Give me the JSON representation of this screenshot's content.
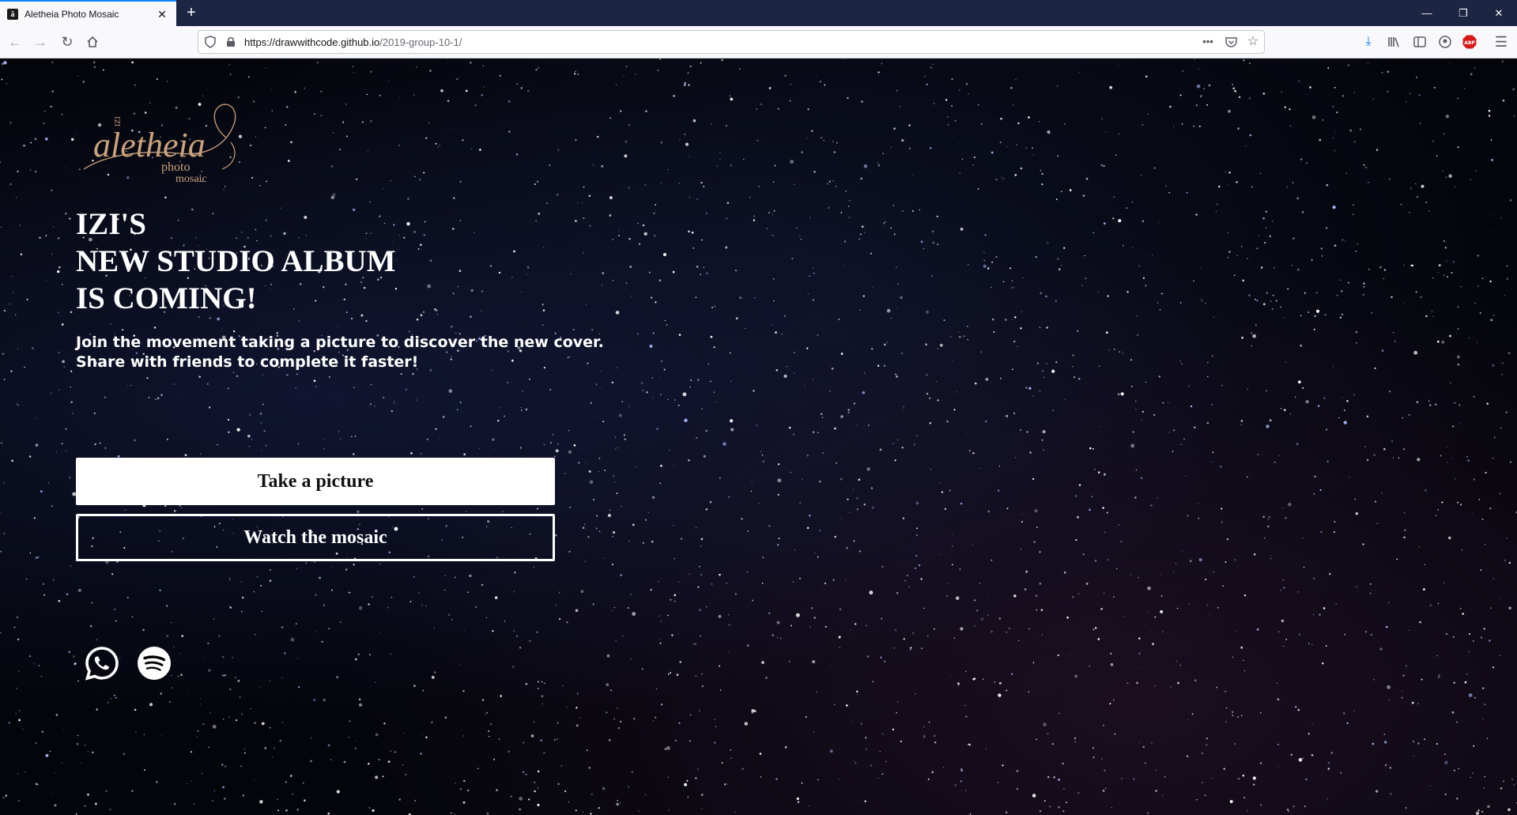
{
  "browser": {
    "tab_title": "Aletheia Photo Mosaic",
    "tab_favicon": "ā",
    "url_host": "https://drawwithcode.github.io",
    "url_path": "/2019-group-10-1/",
    "icons": [
      "back-icon",
      "forward-icon",
      "reload-icon",
      "home-icon",
      "shield-icon",
      "lock-icon",
      "more-icon",
      "pocket-icon",
      "star-icon",
      "download-icon",
      "library-icon",
      "sidebar-icon",
      "account-icon",
      "adblock-icon",
      "menu-icon"
    ],
    "adblock_label": "ABP"
  },
  "logo": {
    "brand": "aletheia",
    "prefix": "IZI",
    "line2": "photo",
    "line3": "mosaic",
    "color": "#c9a27e"
  },
  "hero": {
    "headline": [
      "IZI'S",
      "NEW STUDIO ALBUM",
      "IS COMING!"
    ],
    "subtext": [
      "Join the movement taking a picture to discover the new cover.",
      "Share with friends to complete it faster!"
    ]
  },
  "actions": {
    "take_picture": "Take a picture",
    "watch_mosaic": "Watch the mosaic"
  },
  "social": [
    "whatsapp-icon",
    "spotify-icon"
  ]
}
